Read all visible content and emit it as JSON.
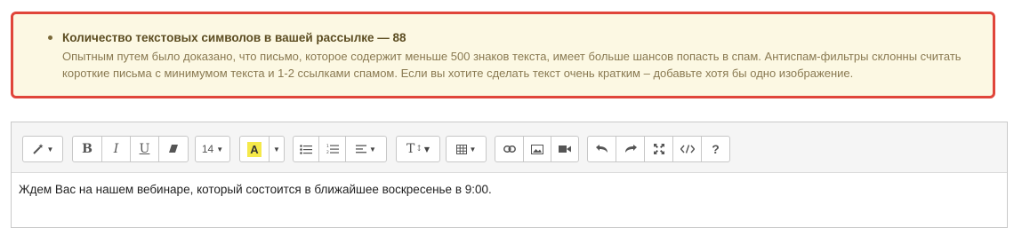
{
  "warning": {
    "title": "Количество текстовых символов в вашей рассылке — 88",
    "body": "Опытным путем было доказано, что письмо, которое содержит меньше 500 знаков текста, имеет больше шансов попасть в спам. Антиспам-фильтры склонны считать короткие письма с минимумом текста и 1-2 ссылками спамом. Если вы хотите сделать текст очень кратким – добавьте хотя бы одно изображение."
  },
  "toolbar": {
    "bold": "B",
    "italic": "I",
    "underline": "U",
    "font_size": "14",
    "highlight": "A",
    "text_format": "T",
    "help": "?"
  },
  "editor": {
    "content": "Ждем Вас на нашем вебинаре, который состоится в ближайшее воскресенье в 9:00."
  },
  "colors": {
    "warning_border": "#e0453a",
    "warning_bg": "#fcf8e3",
    "highlight_yellow": "#f5e94a"
  },
  "icons": [
    "magic-wand-icon",
    "eraser-icon",
    "highlighter-icon",
    "unordered-list-icon",
    "ordered-list-icon",
    "align-icon",
    "table-icon",
    "link-icon",
    "image-icon",
    "video-icon",
    "undo-icon",
    "redo-icon",
    "fullscreen-icon",
    "code-view-icon",
    "help-icon"
  ]
}
